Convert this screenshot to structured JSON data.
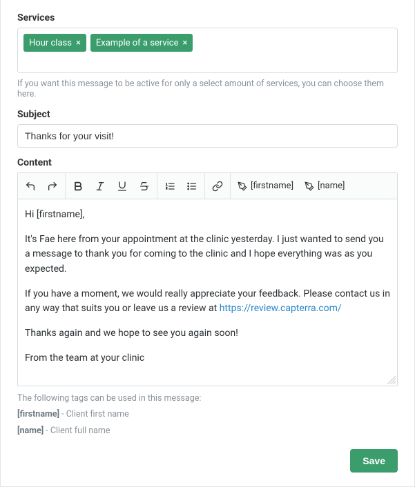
{
  "labels": {
    "services": "Services",
    "services_help": "If you want this message to be active for only a select amount of services, you can choose them here.",
    "subject": "Subject",
    "content": "Content",
    "tags_intro": "The following tags can be used in this message:",
    "tag_firstname_key": "[firstname]",
    "tag_firstname_desc": " - Client first name",
    "tag_name_key": "[name]",
    "tag_name_desc": " - Client full name",
    "save": "Save"
  },
  "services": {
    "tags": [
      {
        "label": "Hour class"
      },
      {
        "label": "Example of a service"
      }
    ]
  },
  "subject": {
    "value": "Thanks for your visit!"
  },
  "toolbar": {
    "firstname_token": "[firstname]",
    "name_token": "[name]"
  },
  "content": {
    "p1": "Hi [firstname],",
    "p2": "It's Fae here from your appointment at the clinic yesterday. I just wanted to send you a message to thank you for coming to the clinic and I hope everything was as you expected.",
    "p3_before": "If you have a moment, we would really appreciate your feedback. Please contact us in any way that suits you or leave us a review at ",
    "p3_link": "https://review.capterra.com/",
    "p4": "Thanks again and we hope to see you again soon!",
    "p5": "From the team at your clinic"
  }
}
